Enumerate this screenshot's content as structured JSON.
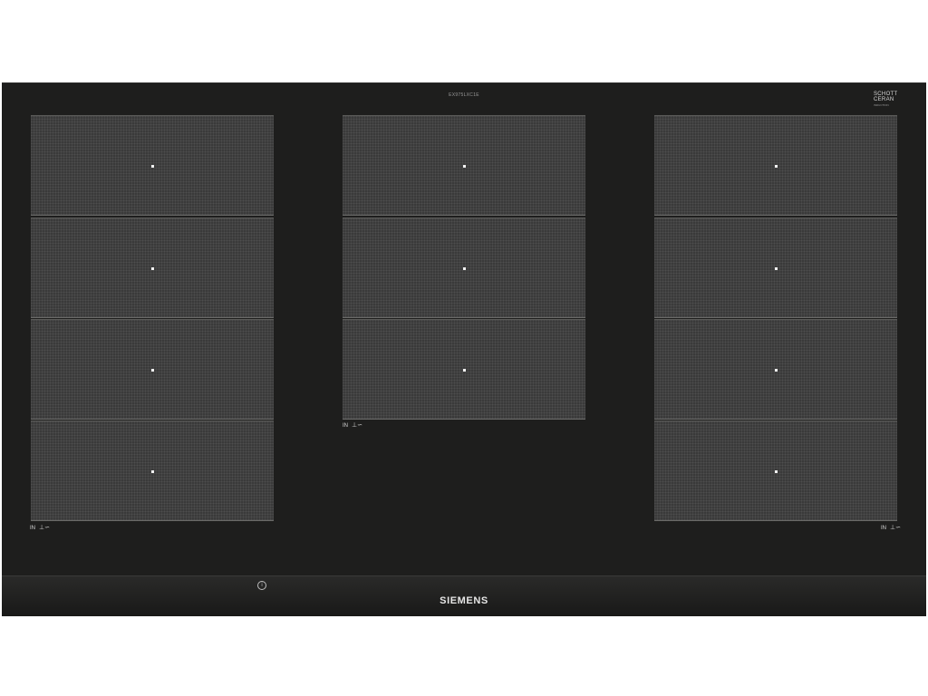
{
  "hob": {
    "model_code": "EX975LXC1E",
    "badge": {
      "line1": "SCHOTT",
      "line2": "CERAN",
      "line3": "INDUCTION"
    },
    "brand": "SIEMENS",
    "info_icon_glyph": "i",
    "zone_labels": [
      {
        "text": "IN",
        "symbol": "⊥∽"
      },
      {
        "text": "IN",
        "symbol": "⊥∽"
      },
      {
        "text": "IN",
        "symbol": "⊥∽"
      }
    ],
    "columns": [
      {
        "zones": 4
      },
      {
        "zones": 3
      },
      {
        "zones": 4
      }
    ]
  }
}
